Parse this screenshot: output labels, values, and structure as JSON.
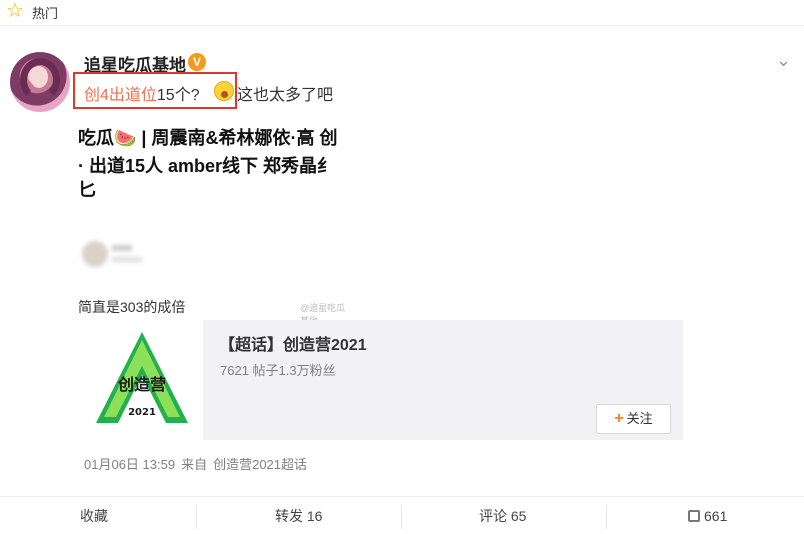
{
  "header": {
    "title": "热门"
  },
  "post": {
    "username": "追星吃瓜基地",
    "verified_badge": "V",
    "text_highlight": "创4出道位",
    "text_mid": "15个?",
    "text_after": "这也太多了吧",
    "image_lines": [
      "吃瓜🍉 | 周震南&希林娜依·高 创",
      "· 出道15人 amber线下 郑秀晶纟",
      "匕"
    ],
    "image_caption": "简直是303的成倍",
    "image_watermark": "@追星吃瓜基地"
  },
  "topic_card": {
    "name": "【超话】创造营2021",
    "stats": "7621 帖子1.3万粉丝",
    "follow_label": "关注",
    "logo_text": "创造营",
    "logo_year": "2021"
  },
  "meta": {
    "date": "01月06日 13:59",
    "source_prefix": "来自",
    "source": "创造营2021超话"
  },
  "actions": {
    "collect": "收藏",
    "repost": "转发 16",
    "comment": "评论 65",
    "like": "661"
  },
  "colors": {
    "accent": "#eb7350",
    "highlight_box": "#d93a2f",
    "follow_plus": "#ff8200",
    "logo_green": "#22b14c"
  },
  "icons": [
    "star-icon",
    "verified-icon",
    "chevron-down-icon",
    "surprised-emoji-icon",
    "plus-icon",
    "thumbs-up-icon"
  ]
}
